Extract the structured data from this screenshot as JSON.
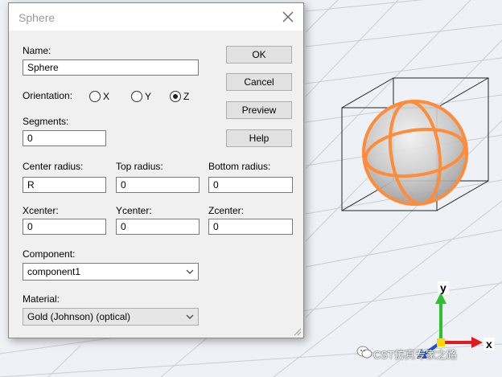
{
  "dialog": {
    "title": "Sphere",
    "name_label": "Name:",
    "name_value": "Sphere",
    "orientation_label": "Orientation:",
    "orientation_options": [
      "X",
      "Y",
      "Z"
    ],
    "orientation_selected": "Z",
    "segments_label": "Segments:",
    "segments_value": "0",
    "center_radius_label": "Center radius:",
    "center_radius_value": "R",
    "top_radius_label": "Top radius:",
    "top_radius_value": "0",
    "bottom_radius_label": "Bottom radius:",
    "bottom_radius_value": "0",
    "xcenter_label": "Xcenter:",
    "xcenter_value": "0",
    "ycenter_label": "Ycenter:",
    "ycenter_value": "0",
    "zcenter_label": "Zcenter:",
    "zcenter_value": "0",
    "component_label": "Component:",
    "component_value": "component1",
    "material_label": "Material:",
    "material_value": "Gold (Johnson) (optical)",
    "buttons": {
      "ok": "OK",
      "cancel": "Cancel",
      "preview": "Preview",
      "help": "Help"
    }
  },
  "viewport": {
    "axes": {
      "y": "y",
      "x": "x"
    },
    "colors": {
      "sphere_outline": "#ff8c3a",
      "x_axis": "#e01b1b",
      "y_axis": "#2ec02e",
      "z_axis": "#1f4fd8"
    }
  },
  "watermark": "CST仿真专家之路"
}
